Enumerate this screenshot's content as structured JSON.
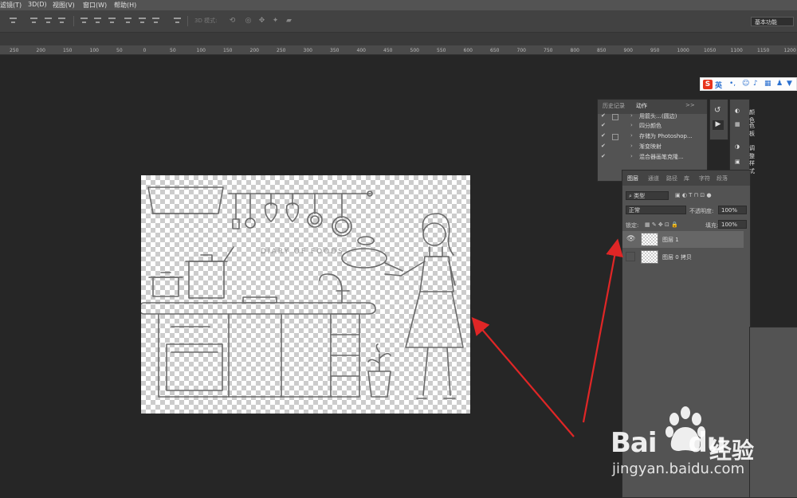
{
  "menu": [
    "滤镜(T)",
    "3D(D)",
    "视图(V)",
    "窗口(W)",
    "帮助(H)"
  ],
  "options_bar": {
    "mode_3d": "3D 模式:",
    "workspace": "基本功能"
  },
  "ruler_ticks": [
    "250",
    "200",
    "150",
    "100",
    "50",
    "0",
    "50",
    "100",
    "150",
    "200",
    "250",
    "300",
    "350",
    "400",
    "450",
    "500",
    "550",
    "600",
    "650",
    "700",
    "750",
    "800",
    "850",
    "900",
    "950",
    "1000",
    "1050",
    "1100",
    "1150",
    "1200"
  ],
  "ime": {
    "logo": "S",
    "lang": "英"
  },
  "history_panel": {
    "tabs": [
      "历史记录",
      "动作"
    ],
    "rows": [
      {
        "checked": true,
        "box": true,
        "label": "用箭头…(圆边)"
      },
      {
        "checked": true,
        "box": false,
        "label": "四分颜色"
      },
      {
        "checked": true,
        "box": true,
        "label": "存储为 Photoshop..."
      },
      {
        "checked": true,
        "box": false,
        "label": "渐变映射"
      },
      {
        "checked": true,
        "box": false,
        "label": "混合器画笔克隆..."
      }
    ]
  },
  "side_dock": {
    "items": [
      "颜色",
      "色板",
      "调整",
      "样式"
    ]
  },
  "layers_panel": {
    "tabs": [
      "图层",
      "通道",
      "路径",
      "库",
      "字符",
      "段落"
    ],
    "filter_kind": "类型",
    "blend_mode": "正常",
    "opacity_label": "不透明度:",
    "opacity": "100%",
    "lock_label": "锁定:",
    "fill_label": "填充:",
    "fill": "100%",
    "layers": [
      {
        "name": "图层 1",
        "visible": true,
        "selected": true
      },
      {
        "name": "图层 0 拷贝",
        "visible": false,
        "selected": false
      }
    ]
  },
  "canvas_artwork_text": "DIARY OF FOODS",
  "watermark": {
    "brand_latin": "Bai",
    "brand_latin_end": "du",
    "brand_cn": "经验",
    "url": "jingyan.baidu.com"
  },
  "colors": {
    "annotation_arrow": "#e02626",
    "ime_accent": "#2a70d0",
    "ime_logo": "#e8341c"
  }
}
